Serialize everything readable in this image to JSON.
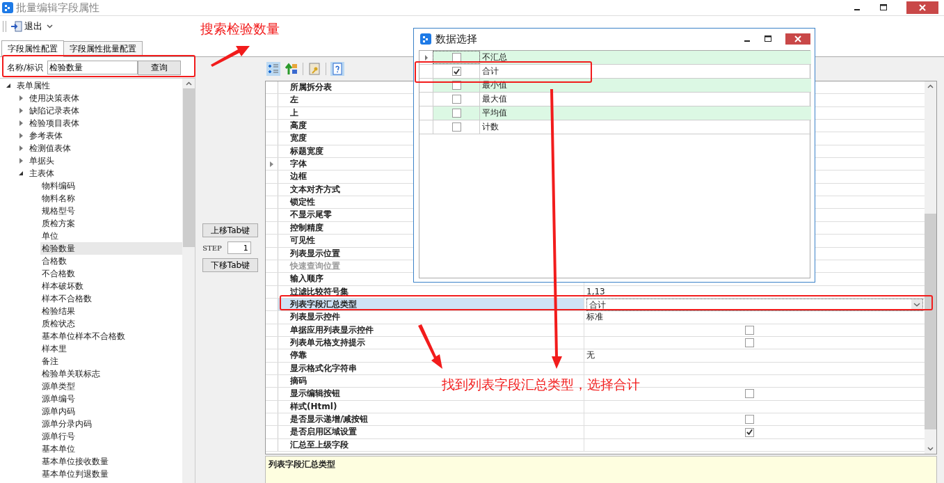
{
  "window": {
    "title": "批量编辑字段属性"
  },
  "toolbar": {
    "exit_label": "退出"
  },
  "tabs": [
    {
      "label": "字段属性配置",
      "selected": true
    },
    {
      "label": "字段属性批量配置",
      "selected": false
    }
  ],
  "search": {
    "label": "名称/标识",
    "value": "检验数量",
    "button": "查询"
  },
  "tree": [
    {
      "label": "表单属性",
      "expanded": true,
      "selected": false,
      "children": [
        {
          "label": "使用决策表体",
          "expanded": false,
          "selected": false
        },
        {
          "label": "缺陷记录表体",
          "expanded": false,
          "selected": false
        },
        {
          "label": "检验项目表体",
          "expanded": false,
          "selected": false
        },
        {
          "label": "参考表体",
          "expanded": false,
          "selected": false
        },
        {
          "label": "检测值表体",
          "expanded": false,
          "selected": false
        },
        {
          "label": "单据头",
          "expanded": false,
          "selected": false
        },
        {
          "label": "主表体",
          "expanded": true,
          "selected": false,
          "children": [
            {
              "label": "物料编码",
              "selected": false
            },
            {
              "label": "物料名称",
              "selected": false
            },
            {
              "label": "规格型号",
              "selected": false
            },
            {
              "label": "质检方案",
              "selected": false
            },
            {
              "label": "单位",
              "selected": false
            },
            {
              "label": "检验数量",
              "selected": true
            },
            {
              "label": "合格数",
              "selected": false
            },
            {
              "label": "不合格数",
              "selected": false
            },
            {
              "label": "样本破坏数",
              "selected": false
            },
            {
              "label": "样本不合格数",
              "selected": false
            },
            {
              "label": "检验结果",
              "selected": false
            },
            {
              "label": "质检状态",
              "selected": false
            },
            {
              "label": "基本单位样本不合格数",
              "selected": false
            },
            {
              "label": "样本里",
              "selected": false
            },
            {
              "label": "备注",
              "selected": false
            },
            {
              "label": "检验单关联标志",
              "selected": false
            },
            {
              "label": "源单类型",
              "selected": false
            },
            {
              "label": "源单编号",
              "selected": false
            },
            {
              "label": "源单内码",
              "selected": false
            },
            {
              "label": "源单分录内码",
              "selected": false
            },
            {
              "label": "源单行号",
              "selected": false
            },
            {
              "label": "基本单位",
              "selected": false
            },
            {
              "label": "基本单位接收数量",
              "selected": false
            },
            {
              "label": "基本单位判退数量",
              "selected": false
            }
          ]
        }
      ]
    }
  ],
  "tab_order": {
    "up_button": "上移Tab键",
    "step_label": "STEP",
    "step_value": "1",
    "down_button": "下移Tab键"
  },
  "properties": [
    {
      "name": "所属拆分表",
      "kind": "text",
      "selected": false
    },
    {
      "name": "左",
      "kind": "text",
      "selected": false
    },
    {
      "name": "上",
      "kind": "text",
      "selected": false
    },
    {
      "name": "高度",
      "kind": "text",
      "selected": false
    },
    {
      "name": "宽度",
      "kind": "text",
      "selected": false
    },
    {
      "name": "标题宽度",
      "kind": "text",
      "selected": false
    },
    {
      "name": "字体",
      "kind": "group",
      "expanded": false,
      "selected": false
    },
    {
      "name": "边框",
      "kind": "text",
      "selected": false
    },
    {
      "name": "文本对齐方式",
      "kind": "text",
      "selected": false
    },
    {
      "name": "锁定性",
      "kind": "text",
      "selected": false
    },
    {
      "name": "不显示尾零",
      "kind": "text",
      "selected": false
    },
    {
      "name": "控制精度",
      "kind": "text",
      "selected": false
    },
    {
      "name": "可见性",
      "kind": "text",
      "selected": false
    },
    {
      "name": "列表显示位置",
      "kind": "text",
      "selected": false
    },
    {
      "name": "快速查询位置",
      "kind": "text",
      "disabled": true,
      "selected": false
    },
    {
      "name": "输入顺序",
      "kind": "text",
      "selected": false
    },
    {
      "name": "过滤比较符号集",
      "kind": "text",
      "value": "1,13",
      "selected": false
    },
    {
      "name": "列表字段汇总类型",
      "kind": "dropdown",
      "value": "合计",
      "selected": true
    },
    {
      "name": "列表显示控件",
      "kind": "text",
      "value": "标准",
      "selected": false
    },
    {
      "name": "单据应用列表显示控件",
      "kind": "checkbox",
      "checked": false,
      "selected": false
    },
    {
      "name": "列表单元格支持提示",
      "kind": "checkbox",
      "checked": false,
      "selected": false
    },
    {
      "name": "停靠",
      "kind": "text",
      "value": "无",
      "selected": false
    },
    {
      "name": "显示格式化字符串",
      "kind": "text",
      "selected": false
    },
    {
      "name": "摘码",
      "kind": "text",
      "selected": false
    },
    {
      "name": "显示编辑按钮",
      "kind": "checkbox",
      "checked": false,
      "selected": false
    },
    {
      "name": "样式(Html)",
      "kind": "text",
      "selected": false
    },
    {
      "name": "是否显示递增/减按钮",
      "kind": "checkbox",
      "checked": false,
      "selected": false
    },
    {
      "name": "是否启用区域设置",
      "kind": "checkbox",
      "checked": true,
      "selected": false
    },
    {
      "name": "汇总至上级字段",
      "kind": "text",
      "selected": false
    }
  ],
  "description": {
    "title": "列表字段汇总类型"
  },
  "dialog": {
    "title": "数据选择",
    "rows": [
      {
        "label": "不汇总",
        "checked": false,
        "current": true
      },
      {
        "label": "合计",
        "checked": true,
        "current": false
      },
      {
        "label": "最小值",
        "checked": false,
        "current": false
      },
      {
        "label": "最大值",
        "checked": false,
        "current": false
      },
      {
        "label": "平均值",
        "checked": false,
        "current": false
      },
      {
        "label": "计数",
        "checked": false,
        "current": false
      }
    ]
  },
  "annotations": {
    "search_note": "搜索检验数量",
    "find_note": "找到列表字段汇总类型，选择合计"
  }
}
